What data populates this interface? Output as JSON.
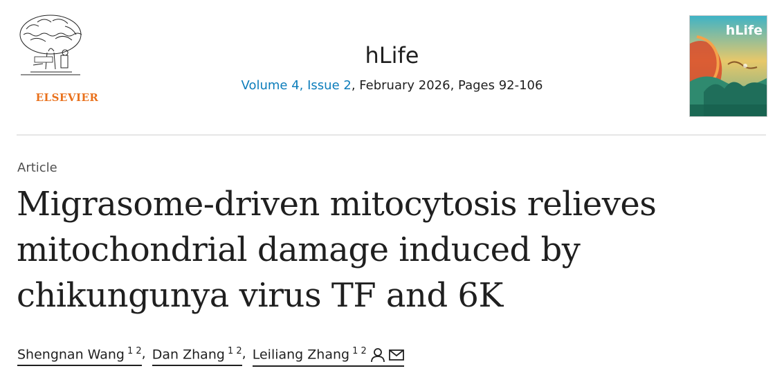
{
  "publisher": {
    "name": "ELSEVIER",
    "brand_color": "#e9711c"
  },
  "journal": {
    "title": "hLife",
    "volume_issue": "Volume 4, Issue 2",
    "issue_details": ", February 2026, Pages 92-106",
    "cover_title": "hLife",
    "link_color": "#0c7dbb"
  },
  "article": {
    "type": "Article",
    "title": "Migrasome-driven mitocytosis relieves mitochondrial damage induced by chikungunya virus TF and 6K"
  },
  "authors": [
    {
      "name": "Shengnan Wang",
      "affiliations": "1 2",
      "separator": ","
    },
    {
      "name": "Dan Zhang",
      "affiliations": "1 2",
      "separator": ","
    },
    {
      "name": "Leiliang Zhang",
      "affiliations": "1 2",
      "icons": [
        "person-icon",
        "envelope-icon"
      ]
    }
  ]
}
